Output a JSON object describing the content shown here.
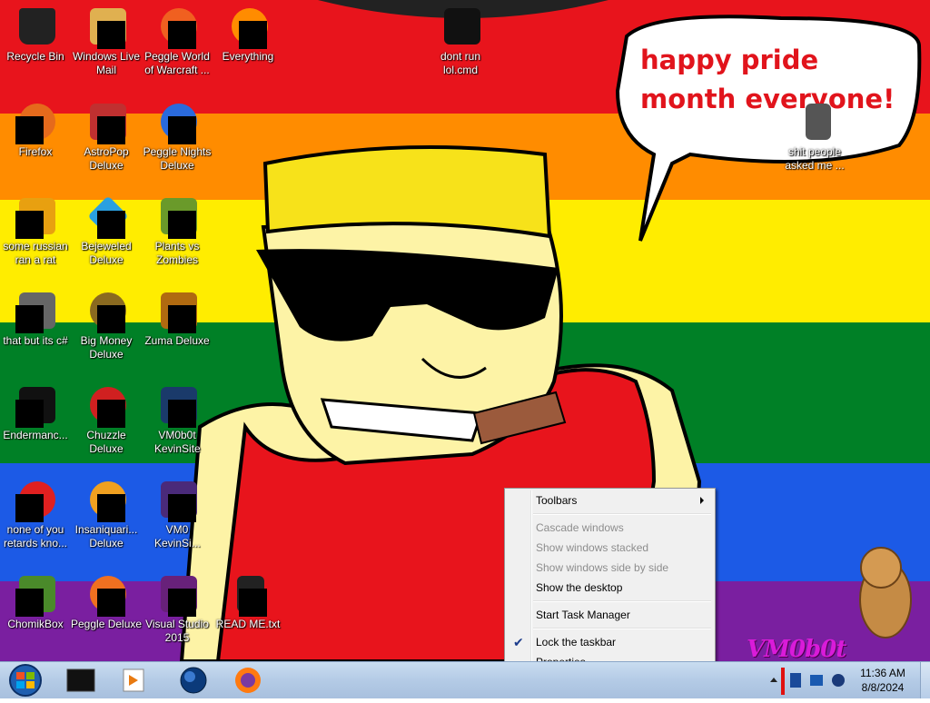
{
  "desktop": {
    "icons": [
      {
        "label": "Recycle Bin",
        "icon": "recycle-bin-icon"
      },
      {
        "label": "Windows Live Mail",
        "icon": "mail-icon"
      },
      {
        "label": "Peggle World of Warcraft ...",
        "icon": "peggle-icon"
      },
      {
        "label": "Everything",
        "icon": "search-icon"
      },
      {
        "label": "dont run lol.cmd",
        "icon": "cmd-icon"
      },
      {
        "label": "Firefox",
        "icon": "firefox-icon"
      },
      {
        "label": "AstroPop Deluxe",
        "icon": "game-icon"
      },
      {
        "label": "Peggle Nights Deluxe",
        "icon": "peggle-icon"
      },
      {
        "label": "shit people asked me ...",
        "icon": "folder-icon"
      },
      {
        "label": "some russian ran a rat",
        "icon": "exe-icon"
      },
      {
        "label": "Bejeweled Deluxe",
        "icon": "gem-icon"
      },
      {
        "label": "Plants vs Zombies",
        "icon": "plant-icon"
      },
      {
        "label": "that but its c#",
        "icon": "shortcut-icon"
      },
      {
        "label": "Big Money Deluxe",
        "icon": "money-icon"
      },
      {
        "label": "Zuma Deluxe",
        "icon": "zuma-icon"
      },
      {
        "label": "Endermanc...",
        "icon": "console-icon"
      },
      {
        "label": "Chuzzle Deluxe",
        "icon": "chuzzle-icon"
      },
      {
        "label": "VM0b0t KevinSite",
        "icon": "vm-icon"
      },
      {
        "label": "none of you retards kno...",
        "icon": "app-icon"
      },
      {
        "label": "Insaniquari... Deluxe",
        "icon": "fish-icon"
      },
      {
        "label": "VM0 KevinSi...",
        "icon": "vm-icon"
      },
      {
        "label": "ChomikBox",
        "icon": "hamster-icon"
      },
      {
        "label": "Peggle Deluxe",
        "icon": "peggle-icon"
      },
      {
        "label": "Visual Studio 2015",
        "icon": "visual-studio-icon"
      },
      {
        "label": "READ ME.txt",
        "icon": "text-file-icon"
      }
    ],
    "bubble_text": "happy pride month everyone!",
    "watermark": "VM0b0t"
  },
  "context_menu": {
    "items": [
      {
        "label": "Toolbars",
        "enabled": true,
        "submenu": true
      },
      {
        "label": "Cascade windows",
        "enabled": false
      },
      {
        "label": "Show windows stacked",
        "enabled": false
      },
      {
        "label": "Show windows side by side",
        "enabled": false
      },
      {
        "label": "Show the desktop",
        "enabled": true
      },
      {
        "label": "Start Task Manager",
        "enabled": true
      },
      {
        "label": "Lock the taskbar",
        "enabled": true,
        "checked": true
      },
      {
        "label": "Properties",
        "enabled": true
      }
    ]
  },
  "taskbar": {
    "pinned": [
      "cmd-icon",
      "media-player-icon",
      "globe-icon",
      "firefox-icon"
    ],
    "clock": {
      "time": "11:36 AM",
      "date": "8/8/2024"
    }
  },
  "colors": {
    "pride_red": "#e8141c",
    "pride_orange": "#ff8c00",
    "pride_yellow": "#ffed00",
    "pride_green": "#008026",
    "pride_blue": "#1c5ae6",
    "pride_purple": "#7a1fa0"
  }
}
